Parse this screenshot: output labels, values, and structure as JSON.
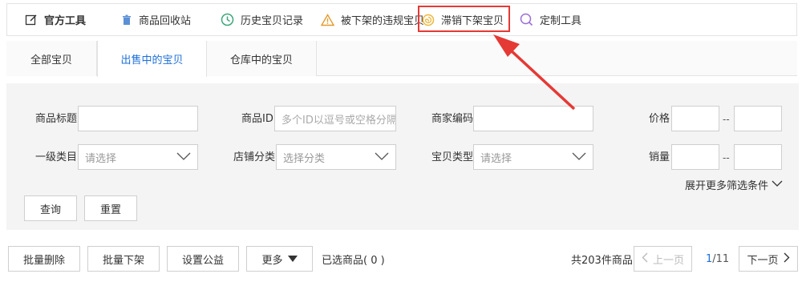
{
  "toolbar": {
    "official_label": "官方工具",
    "recycle_label": "商品回收站",
    "history_label": "历史宝贝记录",
    "violation_label": "被下架的违规宝贝",
    "unsold_label": "滞销下架宝贝",
    "custom_label": "定制工具"
  },
  "tabs": [
    {
      "label": "全部宝贝",
      "active": false
    },
    {
      "label": "出售中的宝贝",
      "active": true
    },
    {
      "label": "仓库中的宝贝",
      "active": false
    }
  ],
  "filters": {
    "title_label": "商品标题",
    "title_value": "",
    "id_label": "商品ID",
    "id_placeholder": "多个ID以逗号或空格分隔",
    "code_label": "商家编码",
    "code_value": "",
    "price_label": "价格",
    "range_sep": "--",
    "category_label": "一级类目",
    "category_placeholder": "请选择",
    "shop_category_label": "店铺分类",
    "shop_category_placeholder": "选择分类",
    "type_label": "宝贝类型",
    "type_placeholder": "请选择",
    "sales_label": "销量",
    "expand_label": "展开更多筛选条件",
    "search_button": "查询",
    "reset_button": "重置"
  },
  "bottom": {
    "batch_delete": "批量删除",
    "batch_offshelf": "批量下架",
    "set_charity": "设置公益",
    "more": "更多",
    "selected": "已选商品( 0 )",
    "total": "共203件商品",
    "prev": "上一页",
    "page_current": "1",
    "page_total": "/11",
    "next": "下一页"
  },
  "colors": {
    "accent": "#1e6fd9",
    "highlight": "#e53935",
    "panel_bg": "#f4f4f4"
  },
  "icons": {
    "official": "edit-icon",
    "recycle": "trash-icon",
    "history": "clock-icon",
    "violation": "warning-icon",
    "unsold": "spiral-icon",
    "custom": "search-icon"
  }
}
